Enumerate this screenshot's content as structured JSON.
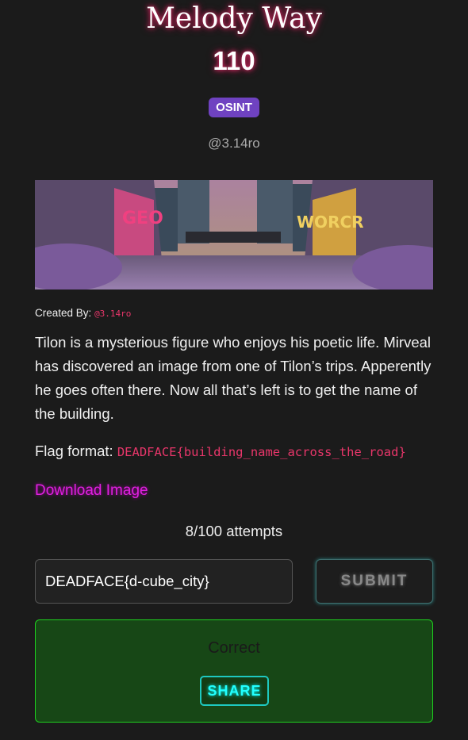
{
  "challenge": {
    "title": "Melody Way",
    "points": "110",
    "category": "OSINT",
    "author": "@3.14ro",
    "created_by_label": "Created By:",
    "created_by_handle": "@3.14ro",
    "description": "Tilon is a mysterious figure who enjoys his poetic life. Mirveal has discovered an image from one of Tilon’s trips. Apperently he goes often there. Now all that’s left is to get the name of the building.",
    "flag_format_label": "Flag format:",
    "flag_format": "DEADFACE{building_name_across_the_road}",
    "download_label": "Download Image",
    "banner_text": [
      "GEO",
      "WORCR"
    ]
  },
  "submission": {
    "attempts": "8/100 attempts",
    "answer_value": "DEADFACE{d-cube_city}",
    "submit_label": "SUBMIT",
    "result_text": "Correct",
    "share_label": "SHARE"
  },
  "colors": {
    "background": "#1b1b1b",
    "category": "#6f42c1",
    "accent_pink": "#e8366a",
    "link": "#e020e0",
    "success_border": "#1fd01f",
    "share": "#22ffff"
  }
}
